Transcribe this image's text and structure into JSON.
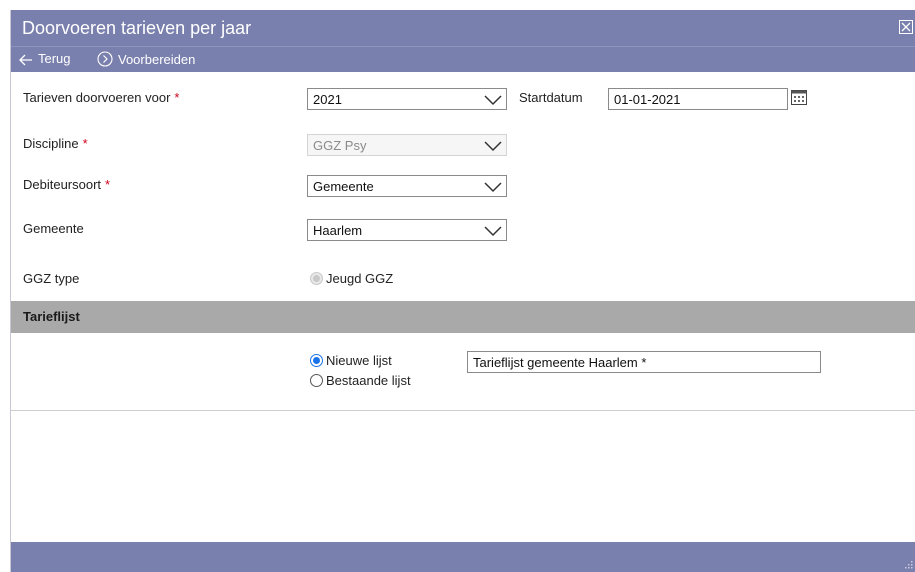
{
  "dialog": {
    "title": "Doorvoeren tarieven per jaar",
    "close_icon": "close-icon"
  },
  "toolbar": {
    "back_label": "Terug",
    "prepare_label": "Voorbereiden"
  },
  "form": {
    "required_mark": "*",
    "year": {
      "label": "Tarieven doorvoeren voor",
      "value": "2021"
    },
    "start_date": {
      "label": "Startdatum",
      "value": "01-01-2021"
    },
    "discipline": {
      "label": "Discipline",
      "value": "GGZ Psy"
    },
    "debtor_type": {
      "label": "Debiteursoort",
      "value": "Gemeente"
    },
    "municipality": {
      "label": "Gemeente",
      "value": "Haarlem"
    },
    "ggz_type": {
      "label": "GGZ type",
      "option": "Jeugd GGZ"
    }
  },
  "tariff_list": {
    "section_title": "Tarieflijst",
    "new_list_label": "Nieuwe lijst",
    "existing_list_label": "Bestaande lijst",
    "list_name": "Tarieflijst gemeente Haarlem *"
  },
  "colors": {
    "header_bg": "#7a80ad",
    "section_bg": "#a9a9a9",
    "required": "#d0021b",
    "radio_accent": "#1a73e8"
  }
}
